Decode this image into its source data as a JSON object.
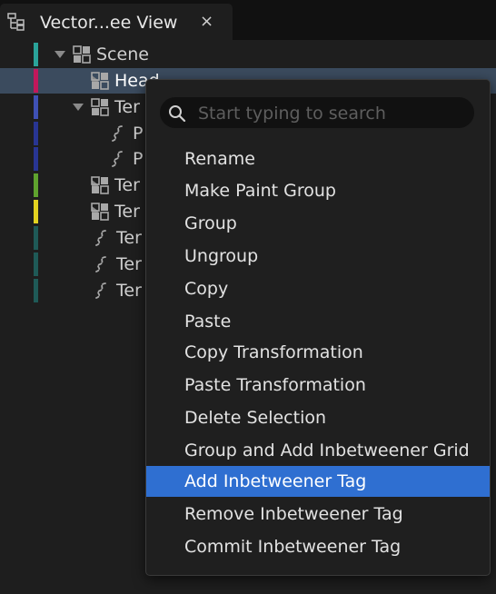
{
  "tab": {
    "title": "Vector...ee View",
    "close_glyph": "×",
    "icon": "tree-view-icon"
  },
  "tree": {
    "rows": [
      {
        "label": "Scene",
        "color": "#2aa39a",
        "expander": "expanded",
        "icon": "group-icon"
      },
      {
        "label": "Head",
        "color": "#c2185b",
        "expander": "collapsed",
        "icon": "group-icon",
        "selected": true
      },
      {
        "label": "Ter",
        "color": "#3f51b5",
        "expander": "expanded",
        "icon": "group-icon"
      },
      {
        "label": "P",
        "color": "#283593",
        "expander": "none",
        "icon": "stroke-icon"
      },
      {
        "label": "P",
        "color": "#283593",
        "expander": "none",
        "icon": "stroke-icon"
      },
      {
        "label": "Ter",
        "color": "#5fa32e",
        "expander": "collapsed",
        "icon": "group-icon"
      },
      {
        "label": "Ter",
        "color": "#e3d220",
        "expander": "collapsed",
        "icon": "group-icon"
      },
      {
        "label": "Ter",
        "color": "#1f5a57",
        "expander": "none",
        "icon": "stroke-icon"
      },
      {
        "label": "Ter",
        "color": "#1f5a57",
        "expander": "none",
        "icon": "stroke-icon"
      },
      {
        "label": "Ter",
        "color": "#1f5a57",
        "expander": "none",
        "icon": "stroke-icon"
      }
    ]
  },
  "context_menu": {
    "search": {
      "placeholder": "Start typing to search",
      "value": ""
    },
    "items": [
      {
        "label": "Rename"
      },
      {
        "label": "Make Paint Group"
      },
      {
        "label": "Group"
      },
      {
        "label": "Ungroup"
      },
      {
        "label": "Copy"
      },
      {
        "label": "Paste"
      },
      {
        "label": "Copy Transformation"
      },
      {
        "label": "Paste Transformation"
      },
      {
        "label": "Delete Selection"
      },
      {
        "label": "Group and Add Inbetweener Grid"
      },
      {
        "label": "Add Inbetweener Tag",
        "highlighted": true
      },
      {
        "label": "Remove Inbetweener Tag"
      },
      {
        "label": "Commit Inbetweener Tag"
      }
    ]
  },
  "colors": {
    "highlight": "#2f6fd1",
    "selection_row": "#3b4b5e"
  }
}
